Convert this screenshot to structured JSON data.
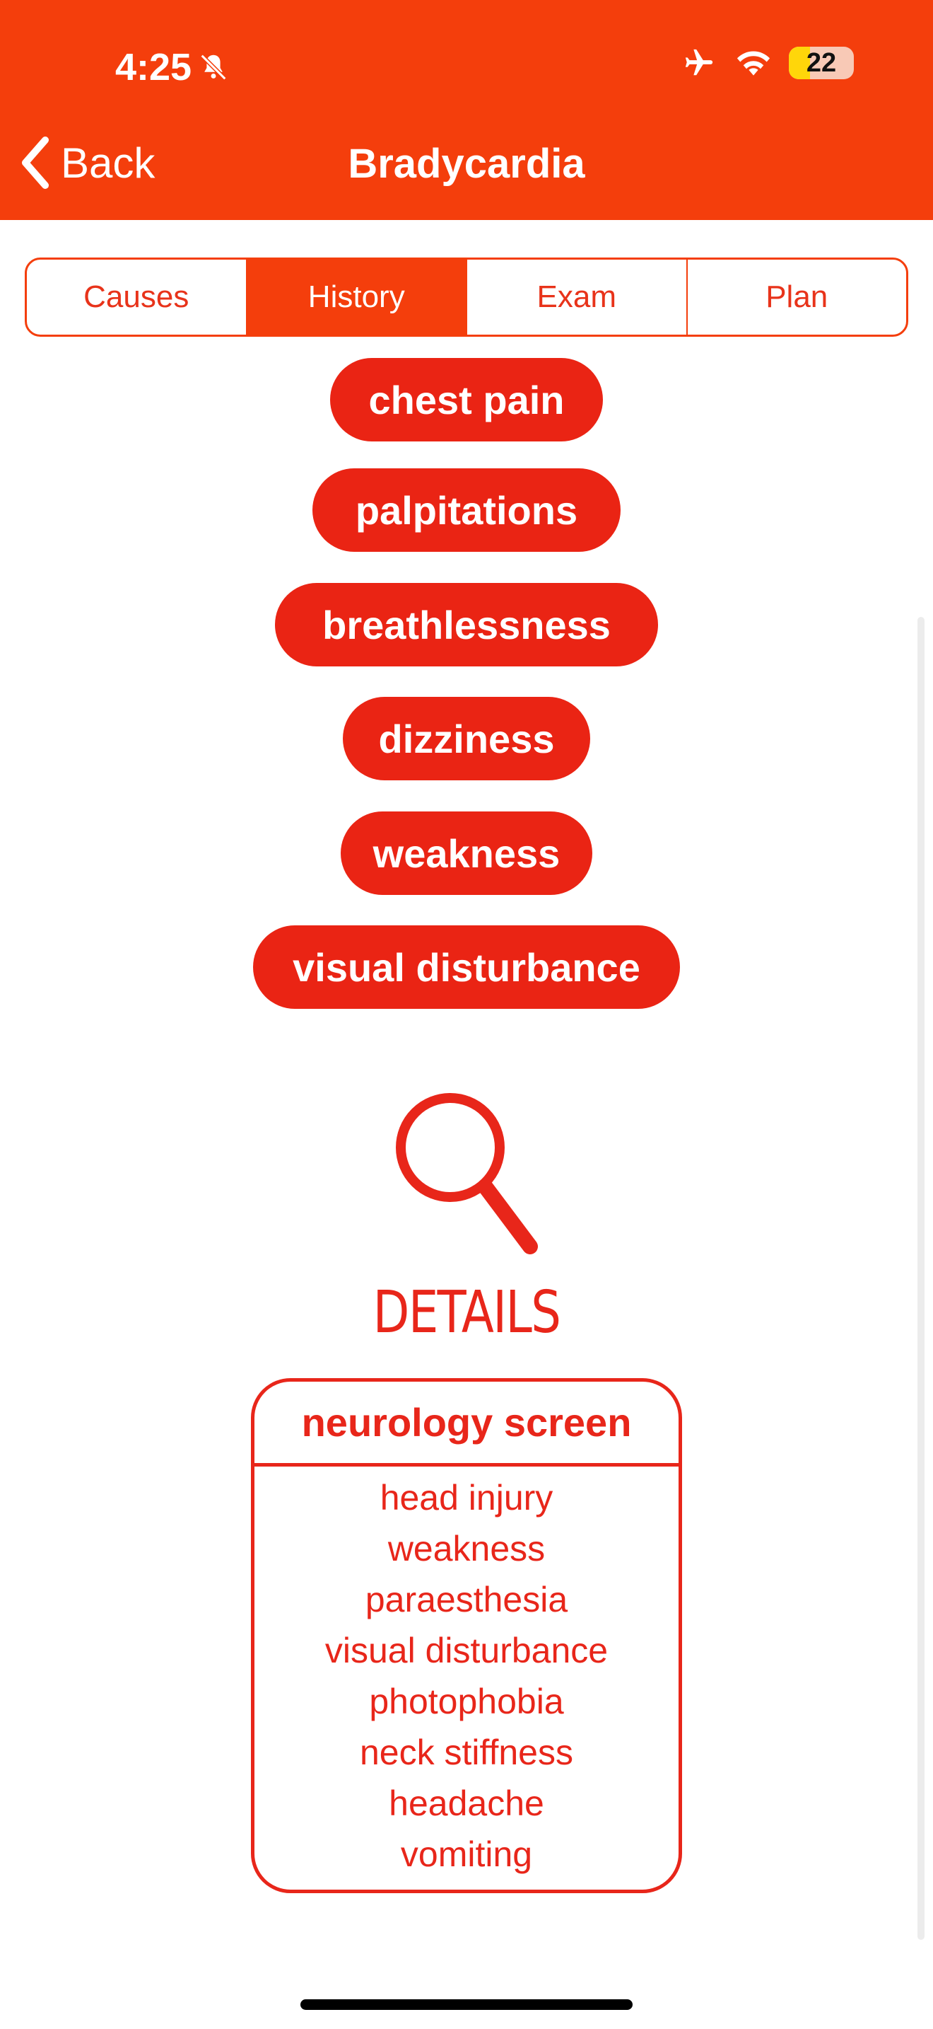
{
  "status": {
    "time": "4:25",
    "battery": "22"
  },
  "nav": {
    "back_label": "Back",
    "title": "Bradycardia"
  },
  "tabs": [
    {
      "label": "Causes",
      "active": false
    },
    {
      "label": "History",
      "active": true
    },
    {
      "label": "Exam",
      "active": false
    },
    {
      "label": "Plan",
      "active": false
    }
  ],
  "symptoms": [
    "chest pain",
    "palpitations",
    "breathlessness",
    "dizziness",
    "weakness",
    "visual disturbance"
  ],
  "details": {
    "title": "DETAILS",
    "card": {
      "title": "neurology screen",
      "items": [
        "head injury",
        "weakness",
        "paraesthesia",
        "visual disturbance",
        "photophobia",
        "neck stiffness",
        "headache",
        "vomiting"
      ]
    }
  },
  "colors": {
    "header": "#f43e0c",
    "pill": "#ea2414",
    "text": "#e8261a"
  }
}
